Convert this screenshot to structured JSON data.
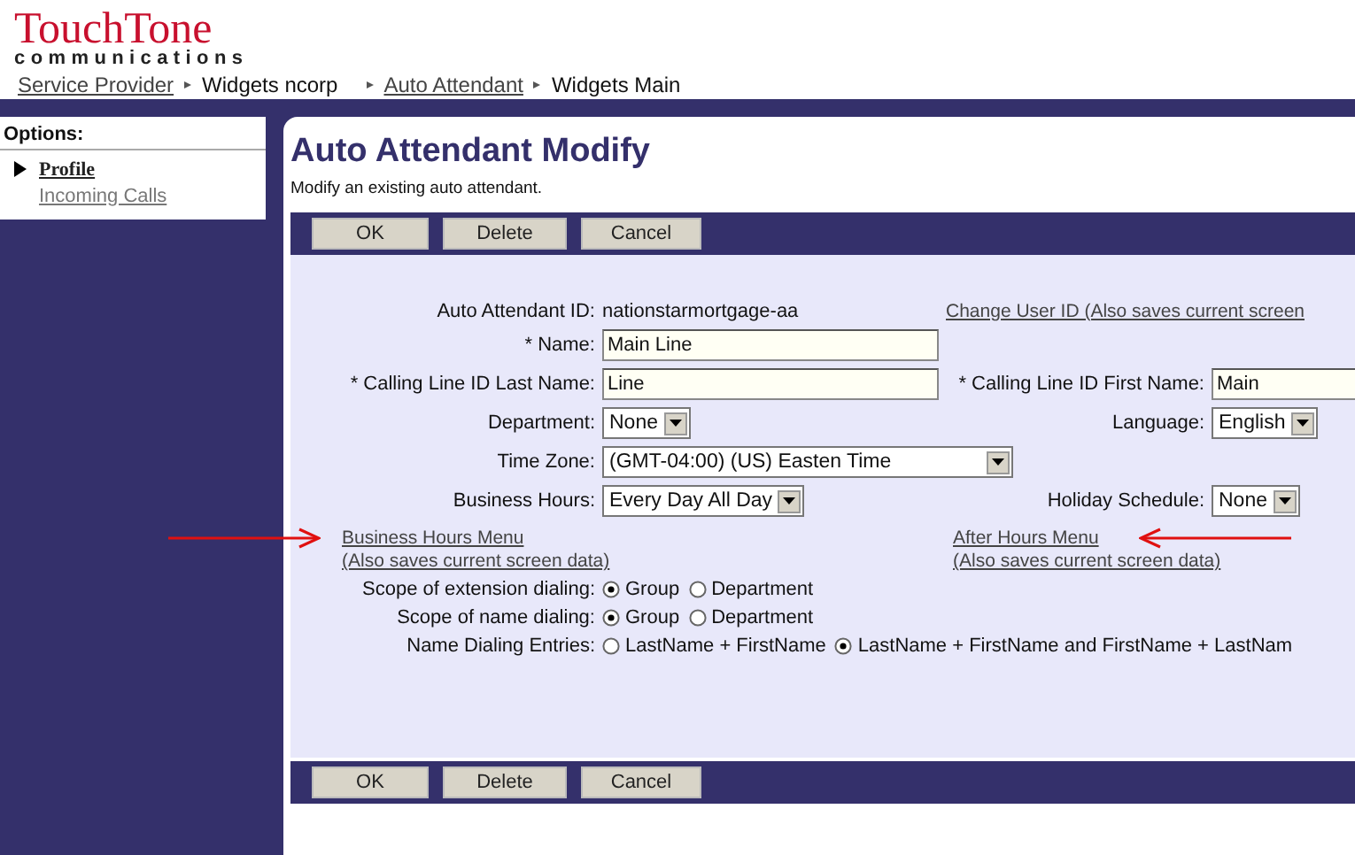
{
  "logo": {
    "name": "TouchTone",
    "tagline": "communications"
  },
  "breadcrumb": [
    {
      "label": "Service Provider",
      "link": true
    },
    {
      "label": "Widgets ncorp",
      "link": false
    },
    {
      "label": "Auto Attendant",
      "link": true
    },
    {
      "label": "Widgets Main",
      "link": false
    }
  ],
  "sidebar": {
    "heading": "Options:",
    "items": [
      {
        "label": "Profile",
        "selected": true
      },
      {
        "label": "Incoming Calls",
        "selected": false
      }
    ]
  },
  "page": {
    "title": "Auto Attendant Modify",
    "description": "Modify an existing auto attendant."
  },
  "buttons": [
    "OK",
    "Delete",
    "Cancel"
  ],
  "form": {
    "auto_attendant_id": {
      "label": "Auto Attendant ID:",
      "value": "nationstarmortgage-aa"
    },
    "change_user_id_link": "Change User ID (Also saves current screen",
    "name": {
      "label": "* Name:",
      "value": "Main Line"
    },
    "last_name": {
      "label": "* Calling Line ID Last Name:",
      "value": "Line"
    },
    "first_name": {
      "label": "* Calling Line ID First Name:",
      "value": "Main"
    },
    "department": {
      "label": "Department:",
      "value": "None"
    },
    "language": {
      "label": "Language:",
      "value": "English"
    },
    "time_zone": {
      "label": "Time Zone:",
      "value": "(GMT-04:00) (US) Easten Time"
    },
    "business_hours": {
      "label": "Business Hours:",
      "value": "Every Day All Day"
    },
    "holiday_schedule": {
      "label": "Holiday Schedule:",
      "value": "None"
    },
    "business_hours_menu_link": {
      "title": "Business Hours Menu",
      "note": "(Also saves current screen data)"
    },
    "after_hours_menu_link": {
      "title": "After Hours Menu",
      "note": "(Also saves current screen data)"
    },
    "radio_rows": [
      {
        "label": "Scope of extension dialing:",
        "options": [
          {
            "label": "Group",
            "selected": true
          },
          {
            "label": "Department",
            "selected": false
          }
        ]
      },
      {
        "label": "Scope of name dialing:",
        "options": [
          {
            "label": "Group",
            "selected": true
          },
          {
            "label": "Department",
            "selected": false
          }
        ]
      },
      {
        "label": "Name Dialing Entries:",
        "options": [
          {
            "label": "LastName + FirstName",
            "selected": false
          },
          {
            "label": "LastName + FirstName and FirstName + LastNam",
            "selected": true
          }
        ]
      }
    ]
  },
  "bottom_buttons": [
    "OK",
    "Delete",
    "Cancel"
  ]
}
